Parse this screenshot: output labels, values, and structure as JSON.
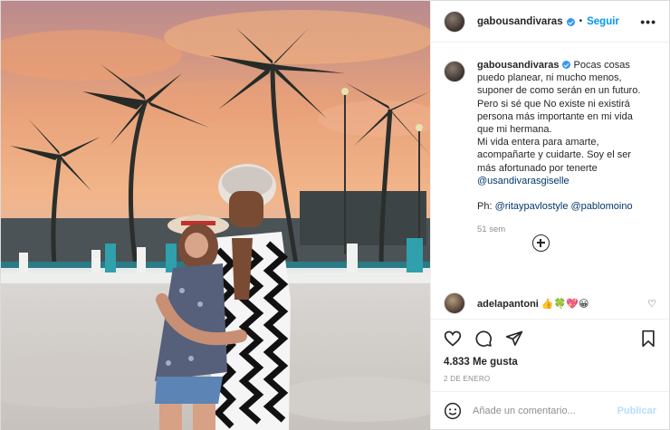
{
  "header": {
    "username": "gabousandivaras",
    "separator": "•",
    "follow_label": "Seguir",
    "more_label": "•••"
  },
  "caption": {
    "username": "gabousandivaras",
    "lines": [
      "Pocas cosas",
      "puedo planear, ni mucho menos,",
      "suponer de como serán en un futuro.",
      "Pero si sé que No existe ni existirá",
      "persona más importante en mi vida",
      "que mi hermana.",
      "Mi vida entera para amarte,",
      "acompañarte y cuidarte. Soy el ser",
      "más afortunado por tenerte"
    ],
    "mention": "@usandivarasgiselle",
    "photo_credit_prefix": "Ph: ",
    "photo_credit_1": "@ritaypavlostyle",
    "photo_credit_2": "@pablomoino",
    "time": "51 sem"
  },
  "comment": {
    "username": "adelapantoni",
    "text": "👍🍀💖😀"
  },
  "actions": {
    "like_icon": "heart-icon",
    "comment_icon": "comment-icon",
    "share_icon": "send-icon",
    "save_icon": "bookmark-icon"
  },
  "likes": "4.833 Me gusta",
  "date": "2 DE ENERO",
  "add_comment": {
    "placeholder": "Añade un comentario...",
    "publish_label": "Publicar"
  },
  "colors": {
    "accent": "#0095f6",
    "verified": "#3897f0",
    "publish_disabled": "#b2dffc"
  }
}
